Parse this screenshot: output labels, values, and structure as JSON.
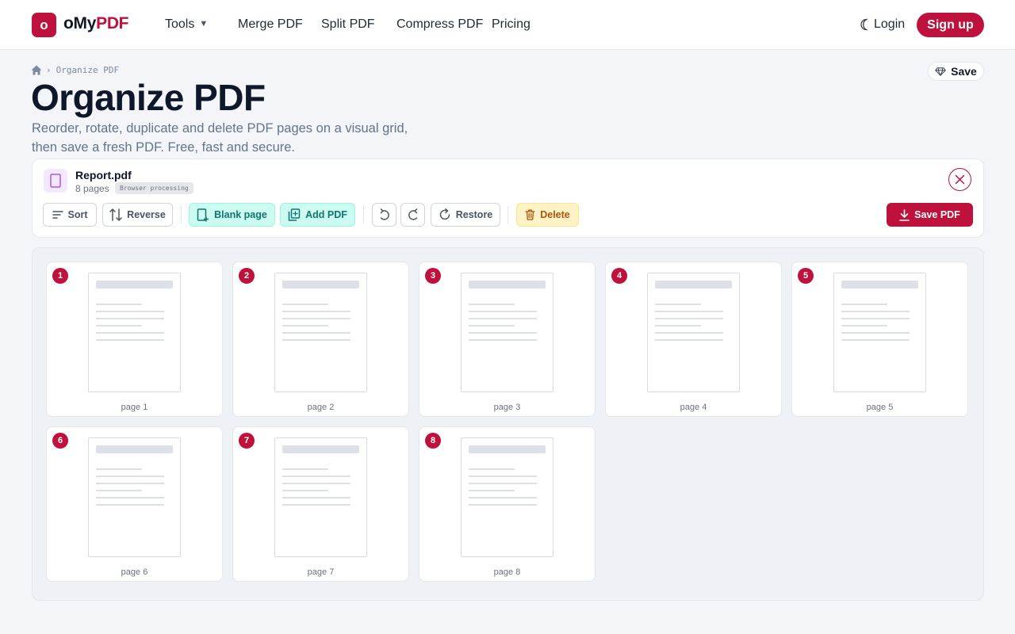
{
  "header": {
    "logo_letter": "o",
    "brand_prefix": "oMy",
    "brand_accent": "PDF",
    "nav": [
      {
        "label": "Tools",
        "has_dropdown": true
      },
      {
        "label": "Merge PDF"
      },
      {
        "label": "Split PDF"
      },
      {
        "label": "Compress PDF"
      },
      {
        "label": "Pricing"
      }
    ],
    "theme_icon": "moon-icon",
    "login_label": "Login",
    "signup_label": "Sign up"
  },
  "breadcrumb": {
    "home_icon": "home-icon",
    "current": "Organize PDF"
  },
  "save_pill_label": "Save",
  "page_title": "Organize PDF",
  "subtitle_line1": "Reorder, rotate, duplicate and delete PDF pages on a visual grid,",
  "subtitle_line2": "then save a fresh PDF. Free, fast and secure.",
  "file": {
    "name": "Report.pdf",
    "pages_text": "8 pages",
    "badge": "Browser processing"
  },
  "toolbar": {
    "sort": "Sort",
    "reverse": "Reverse",
    "blank_page": "Blank page",
    "add_pdf": "Add PDF",
    "restore": "Restore",
    "delete": "Delete",
    "save_pdf": "Save PDF"
  },
  "pages": [
    {
      "number": "1",
      "label": "page 1"
    },
    {
      "number": "2",
      "label": "page 2"
    },
    {
      "number": "3",
      "label": "page 3"
    },
    {
      "number": "4",
      "label": "page 4"
    },
    {
      "number": "5",
      "label": "page 5"
    },
    {
      "number": "6",
      "label": "page 6"
    },
    {
      "number": "7",
      "label": "page 7"
    },
    {
      "number": "8",
      "label": "page 8"
    }
  ],
  "colors": {
    "brand": "#be123c",
    "teal_bg": "#ccfbf1",
    "teal_text": "#0f766e",
    "amber_bg": "#fef3c7",
    "amber_text": "#b45309"
  }
}
